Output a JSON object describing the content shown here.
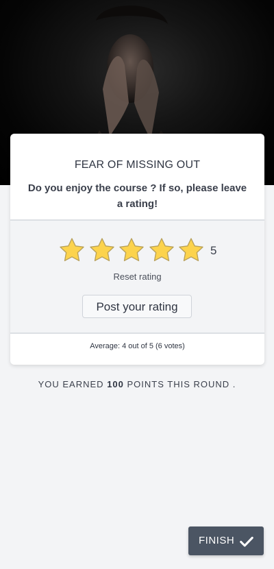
{
  "hero": {
    "image": "woman-covering-face-photo"
  },
  "card": {
    "course_title": "FEAR OF MISSING OUT",
    "prompt": "Do you enjoy the course ? If so, please leave a rating!",
    "rating": {
      "stars_total": 5,
      "stars_selected": 5,
      "value_label": "5",
      "reset_label": "Reset rating",
      "post_label": "Post your rating"
    },
    "average_label": "Average: 4 out of 5 (6 votes)"
  },
  "earned": {
    "prefix": "YOU EARNED",
    "points": "100",
    "suffix": "POINTS THIS ROUND ."
  },
  "finish": {
    "label": "FINISH",
    "icon": "check-icon"
  },
  "colors": {
    "star_fill": "#fcd34d",
    "star_stroke": "#b7a05a",
    "finish_bg": "#4b5563",
    "page_bg": "#f3f4f6"
  }
}
